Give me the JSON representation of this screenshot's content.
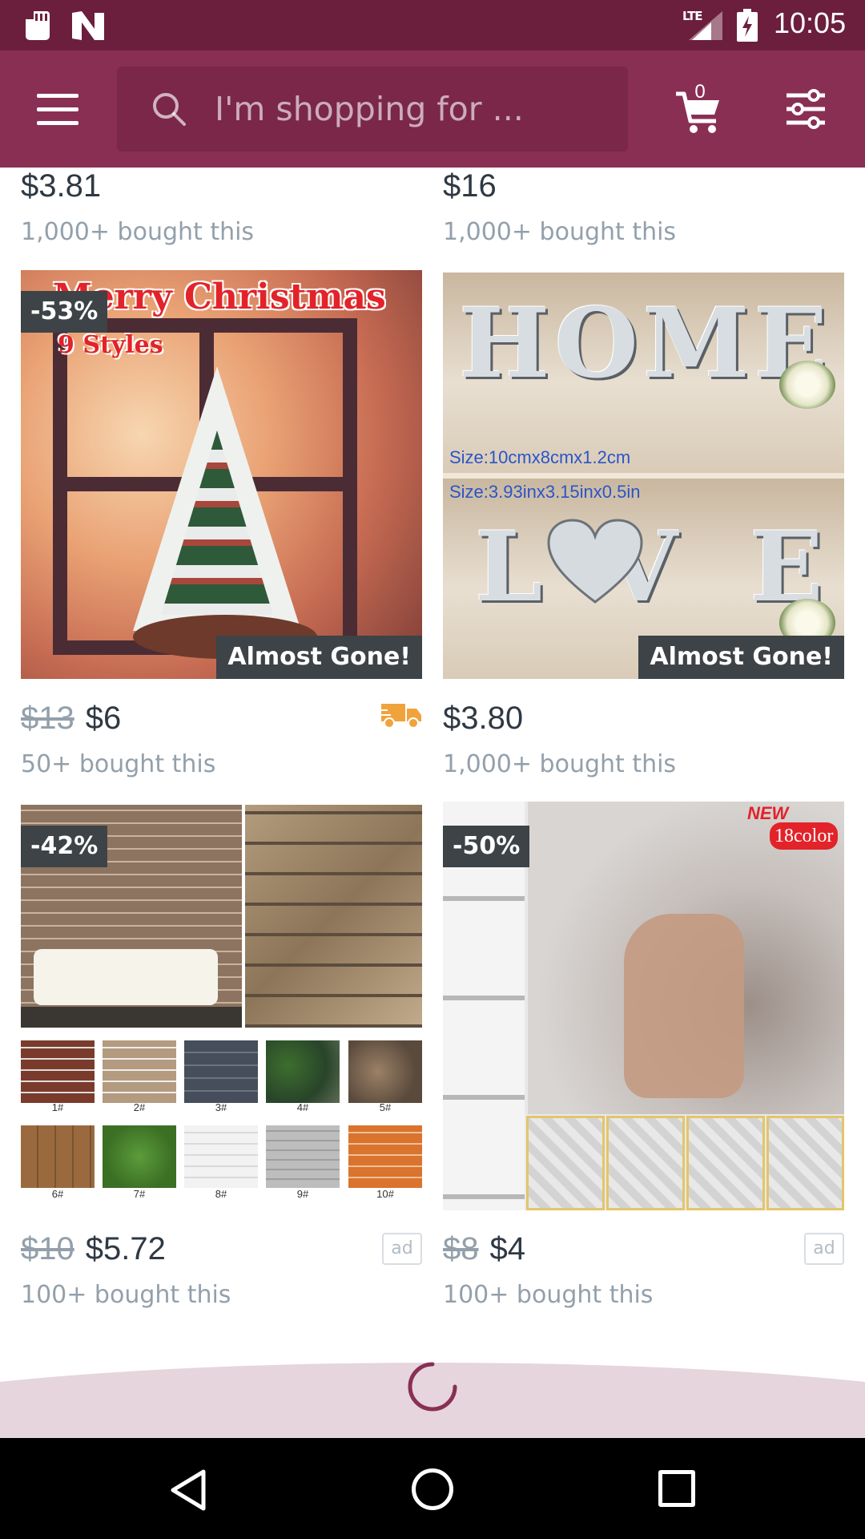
{
  "search": {
    "placeholder": "I'm shopping for ..."
  },
  "cart": {
    "count": "0"
  },
  "status_bar": {
    "network": "LTE",
    "time": "10:05"
  },
  "top_row": [
    {
      "price": "$3.81",
      "bought": "1,000+ bought this"
    },
    {
      "price": "$16",
      "bought": "1,000+ bought this"
    }
  ],
  "products": [
    {
      "discount": "-53%",
      "badge": "Almost Gone!",
      "old_price": "$13",
      "price": "$6",
      "bought": "50+ bought this",
      "image_text": {
        "title": "Merry Christmas",
        "subtitle": "9 Styles"
      }
    },
    {
      "badge": "Almost Gone!",
      "price": "$3.80",
      "bought": "1,000+ bought this",
      "image_text": {
        "word1": "HOME",
        "word2": "LVE",
        "size_cm": "Size:10cmx8cmx1.2cm",
        "size_in": "Size:3.93inx3.15inx0.5in"
      }
    },
    {
      "discount": "-42%",
      "old_price": "$10",
      "price": "$5.72",
      "ad": "ad",
      "bought": "100+ bought this",
      "swatches": [
        "1#",
        "2#",
        "3#",
        "4#",
        "5#",
        "6#",
        "7#",
        "8#",
        "9#",
        "10#"
      ]
    },
    {
      "discount": "-50%",
      "old_price": "$8",
      "price": "$4",
      "ad": "ad",
      "bought": "100+ bought this",
      "image_text": {
        "new": "NEW",
        "colors": "18color"
      }
    }
  ],
  "colors": {
    "status_bar": "#6b1f3c",
    "app_bar": "#8a2f54",
    "accent": "#8a2f54",
    "loader_band": "#e6d5dc",
    "shipping_truck": "#f0a33c"
  }
}
